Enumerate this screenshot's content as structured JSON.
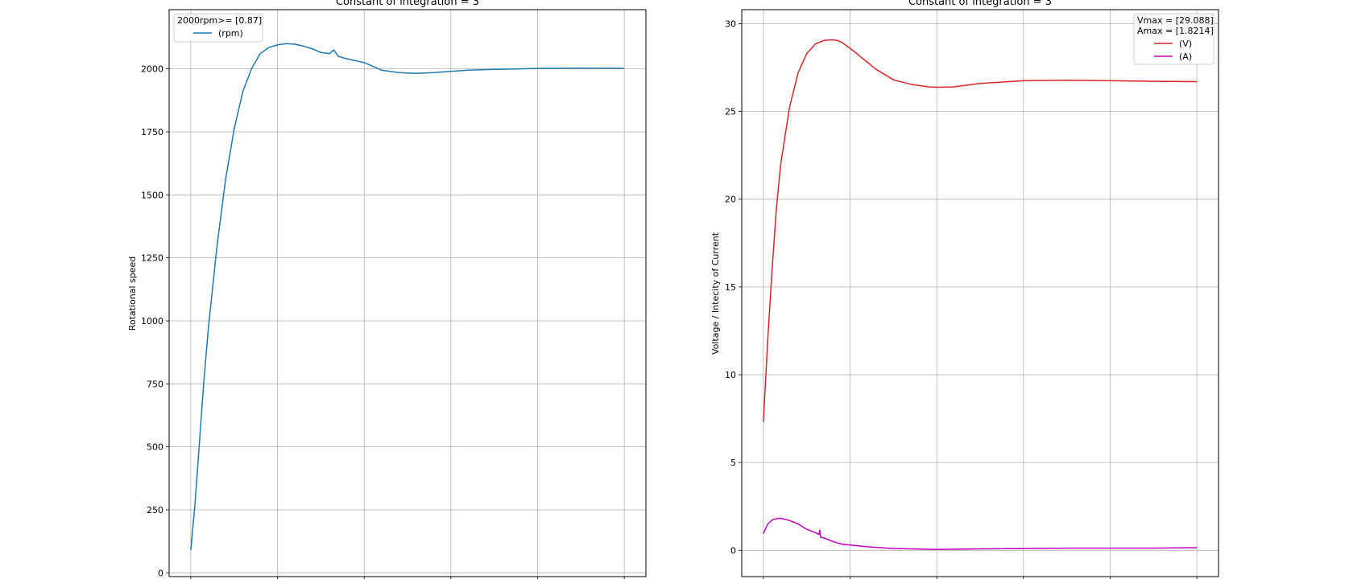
{
  "chart_data": [
    {
      "type": "line",
      "title": "Constant of integration = 3",
      "xlabel": "",
      "ylabel": "Rotational speed",
      "xlim": [
        -0.25,
        5.25
      ],
      "ylim": [
        -15,
        2235
      ],
      "xticks": [
        0,
        1,
        2,
        3,
        4,
        5
      ],
      "yticks": [
        0,
        250,
        500,
        750,
        1000,
        1250,
        1500,
        1750,
        2000
      ],
      "grid": true,
      "legend": {
        "location": "top-left",
        "title": "2000rpm>= [0.87]"
      },
      "series": [
        {
          "name": "(rpm)",
          "color": "#1f77b4",
          "x": [
            0,
            0.05,
            0.1,
            0.15,
            0.2,
            0.3,
            0.4,
            0.5,
            0.6,
            0.7,
            0.8,
            0.9,
            1.0,
            1.1,
            1.2,
            1.3,
            1.4,
            1.5,
            1.6,
            1.65,
            1.7,
            1.8,
            2.0,
            2.2,
            2.4,
            2.6,
            2.8,
            3.0,
            3.2,
            3.5,
            3.8,
            4.0,
            4.5,
            5.0
          ],
          "y": [
            90,
            280,
            520,
            760,
            960,
            1290,
            1560,
            1760,
            1910,
            2000,
            2060,
            2085,
            2095,
            2100,
            2098,
            2090,
            2080,
            2065,
            2060,
            2075,
            2050,
            2040,
            2025,
            1995,
            1985,
            1982,
            1985,
            1990,
            1995,
            1998,
            2000,
            2002,
            2003,
            2002
          ]
        }
      ]
    },
    {
      "type": "line",
      "title": "Constant of integration = 3",
      "xlabel": "",
      "ylabel": "Voltage / Intecity of Current",
      "xlim": [
        -0.25,
        5.25
      ],
      "ylim": [
        -1.5,
        30.8
      ],
      "xticks": [
        0,
        1,
        2,
        3,
        4,
        5
      ],
      "yticks": [
        0,
        5,
        10,
        15,
        20,
        25,
        30
      ],
      "grid": true,
      "legend": {
        "location": "top-right",
        "title_lines": [
          "Vmax = [29.088]",
          "Amax = [1.8214]"
        ]
      },
      "series": [
        {
          "name": "(V)",
          "color": "#d62728",
          "x": [
            0,
            0.05,
            0.1,
            0.15,
            0.2,
            0.3,
            0.4,
            0.5,
            0.6,
            0.7,
            0.8,
            0.85,
            0.9,
            1.0,
            1.1,
            1.2,
            1.3,
            1.5,
            1.7,
            1.9,
            2.0,
            2.2,
            2.5,
            3.0,
            3.5,
            4.0,
            4.5,
            5.0
          ],
          "y": [
            7.3,
            12.0,
            16.0,
            19.5,
            22.0,
            25.2,
            27.2,
            28.3,
            28.85,
            29.05,
            29.08,
            29.05,
            28.95,
            28.6,
            28.2,
            27.8,
            27.4,
            26.8,
            26.55,
            26.4,
            26.38,
            26.4,
            26.6,
            26.75,
            26.78,
            26.75,
            26.72,
            26.7
          ]
        },
        {
          "name": "(A)",
          "color": "#bf00bf",
          "x": [
            0,
            0.05,
            0.1,
            0.15,
            0.2,
            0.3,
            0.4,
            0.5,
            0.6,
            0.64,
            0.65,
            0.66,
            0.7,
            0.8,
            0.9,
            1.0,
            1.2,
            1.5,
            2.0,
            2.5,
            3.0,
            3.5,
            4.0,
            4.5,
            5.0
          ],
          "y": [
            0.95,
            1.5,
            1.72,
            1.8,
            1.82,
            1.7,
            1.5,
            1.2,
            1.0,
            0.9,
            1.15,
            0.75,
            0.7,
            0.5,
            0.35,
            0.3,
            0.2,
            0.1,
            0.05,
            0.08,
            0.1,
            0.12,
            0.12,
            0.12,
            0.15
          ]
        }
      ]
    }
  ]
}
